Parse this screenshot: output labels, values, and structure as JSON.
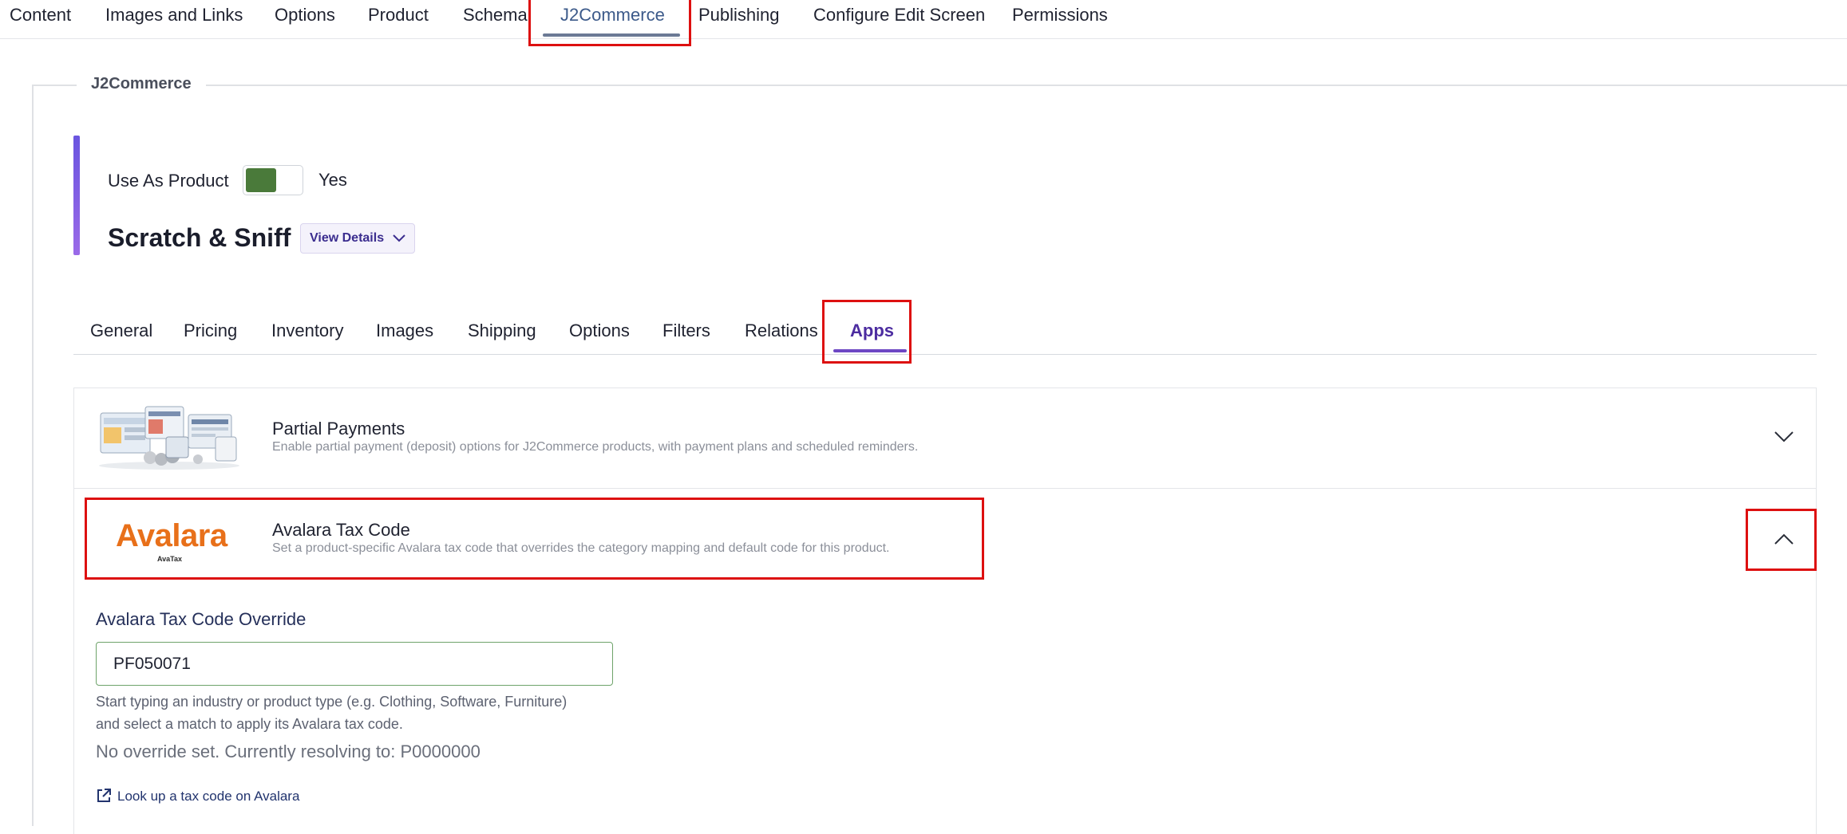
{
  "top_tabs": [
    "Content",
    "Images and Links",
    "Options",
    "Product",
    "Schema",
    "J2Commerce",
    "Publishing",
    "Configure Edit Screen",
    "Permissions"
  ],
  "top_tab_active": "J2Commerce",
  "fieldset_legend": "J2Commerce",
  "product": {
    "use_as_product_label": "Use As Product",
    "use_as_product_state": "Yes",
    "use_as_product_on": true,
    "title": "Scratch & Sniff",
    "view_details_label": "View Details"
  },
  "sub_tabs": [
    "General",
    "Pricing",
    "Inventory",
    "Images",
    "Shipping",
    "Options",
    "Filters",
    "Relations",
    "Apps"
  ],
  "sub_tab_active": "Apps",
  "apps": [
    {
      "name": "Partial Payments",
      "description": "Enable partial payment (deposit) options for J2Commerce products, with payment plans and scheduled reminders.",
      "expanded": false
    },
    {
      "name": "Avalara Tax Code",
      "description": "Set a product-specific Avalara tax code that overrides the category mapping and default code for this product.",
      "expanded": true,
      "logo_text": "Avalara",
      "logo_subtext": "AvaTax"
    }
  ],
  "avalara_form": {
    "label": "Avalara Tax Code Override",
    "value": "PF050071",
    "hint_line1": "Start typing an industry or product type (e.g. Clothing, Software, Furniture)",
    "hint_line2": "and select a match to apply its Avalara tax code.",
    "resolve_text": "No override set. Currently resolving to: P0000000",
    "lookup_link": "Look up a tax code on Avalara"
  },
  "colors": {
    "highlight": "#dd1010",
    "accent_purple": "#6d47c4",
    "toggle_green": "#4a7a3a",
    "avalara_orange": "#e8701a"
  }
}
